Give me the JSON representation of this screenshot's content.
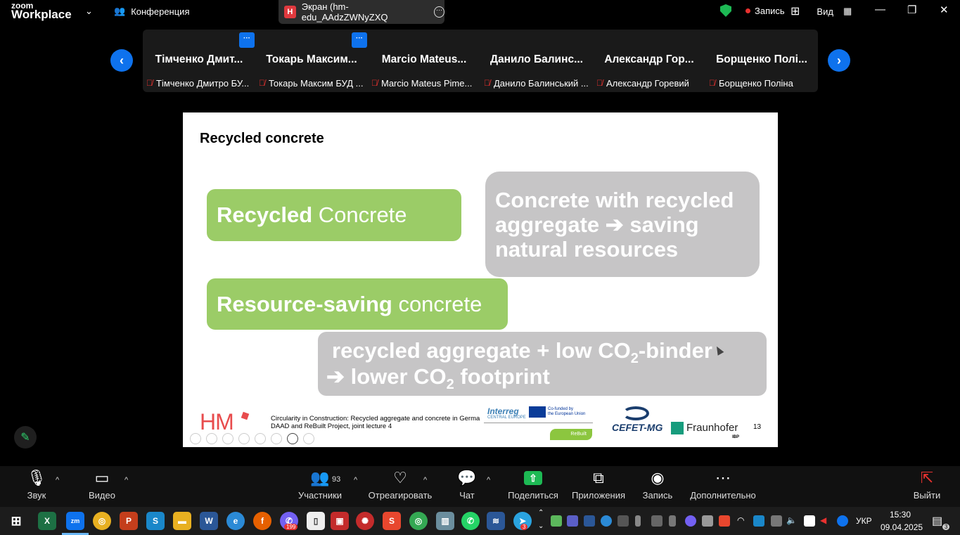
{
  "app": {
    "logo_small": "zoom",
    "logo_big": "Workplace",
    "meeting_label": "Конференция",
    "share_title": "Экран (hm-edu_AAdzZWNyZXQ",
    "share_badge": "H",
    "record_label": "Запись",
    "view_label": "Вид"
  },
  "gallery": {
    "tiles": [
      {
        "display": "Тімченко  Дмит...",
        "name": "Тімченко Дмитро БУ..."
      },
      {
        "display": "Токарь  Максим...",
        "name": "Токарь Максим БУД ..."
      },
      {
        "display": "Marcio  Mateus...",
        "name": "Marcio Mateus Pime..."
      },
      {
        "display": "Данило  Балинс...",
        "name": "Данило Балинський ..."
      },
      {
        "display": "Александр  Гор...",
        "name": "Александр Горевий"
      },
      {
        "display": "Борщенко  Полі...",
        "name": "Борщенко Поліна"
      }
    ],
    "badge_text": "···"
  },
  "slide": {
    "title": "Recycled concrete",
    "box1_bold": "Recycled",
    "box1_rest": " Concrete",
    "box2_line1": "Concrete with recycled",
    "box2_line2": "aggregate ➔ saving",
    "box2_line3": "natural resources",
    "box3_bold": "Resource-saving",
    "box3_rest": " concrete",
    "box4_line1a": "recycled aggregate + low CO",
    "box4_sub1": "2",
    "box4_line1b": "-binder",
    "box4_line2a": "➔ lower CO",
    "box4_sub2": "2",
    "box4_line2b": " footprint",
    "footer_logo": "HM",
    "footer_line1": "Circularity in Construction: Recycled aggregate and concrete in Germa",
    "footer_line2": "DAAD and ReBuilt Project, joint lecture 4",
    "interreg": "Interreg",
    "interreg_sub": "CENTRAL EUROPE",
    "eu_line1": "Co-funded by",
    "eu_line2": "the European Union",
    "rebuilt": "ReBuilt",
    "cefet": "CEFET-MG",
    "fraunhofer": "Fraunhofer",
    "ibp": "IBP",
    "page_number": "13"
  },
  "toolbar": {
    "audio": "Звук",
    "video": "Видео",
    "participants": "Участники",
    "participants_count": "93",
    "react": "Отреагировать",
    "chat": "Чат",
    "share": "Поделиться",
    "apps": "Приложения",
    "record": "Запись",
    "more": "Дополнительно",
    "leave": "Выйти"
  },
  "taskbar": {
    "lang": "УКР",
    "time": "15:30",
    "date": "09.04.2025",
    "viber_badge": "199",
    "telegram_badge": "3",
    "notif_badge": "3"
  },
  "colors": {
    "accent_blue": "#0e72ed",
    "slide_green": "#9bcc67",
    "slide_grey": "#c6c5c6",
    "share_green": "#1db954",
    "record_red": "#e8312f"
  }
}
